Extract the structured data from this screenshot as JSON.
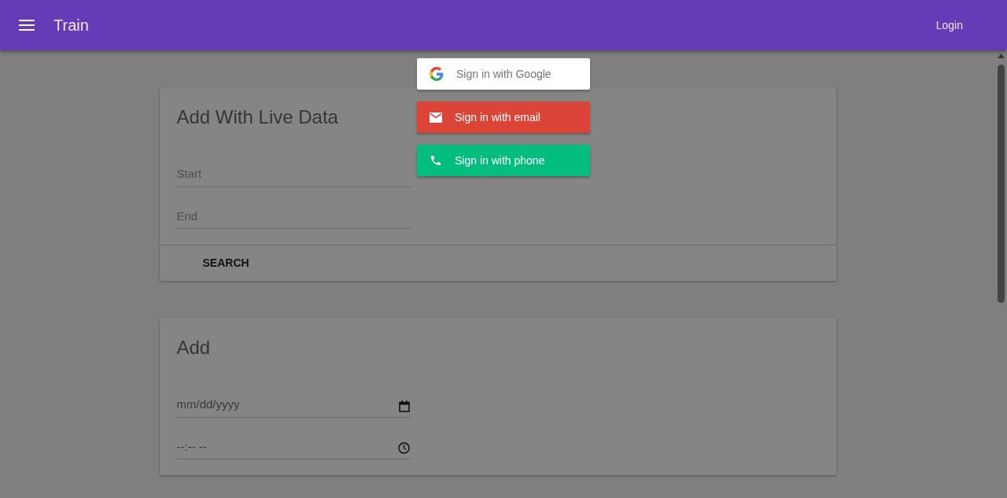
{
  "app_bar": {
    "title": "Train",
    "login": "Login"
  },
  "sign_in": [
    {
      "kind": "google",
      "label": "Sign in with Google"
    },
    {
      "kind": "email",
      "label": "Sign in with email"
    },
    {
      "kind": "phone",
      "label": "Sign in with phone"
    }
  ],
  "cards": [
    {
      "title": "Add With Live Data",
      "fields": [
        {
          "kind": "text",
          "placeholder": "Start"
        },
        {
          "kind": "text",
          "placeholder": "End"
        }
      ],
      "action": "SEARCH"
    },
    {
      "title": "Add",
      "fields": [
        {
          "kind": "date",
          "placeholder": "mm/dd/yyyy"
        },
        {
          "kind": "time",
          "placeholder": "--:-- --"
        }
      ]
    }
  ]
}
